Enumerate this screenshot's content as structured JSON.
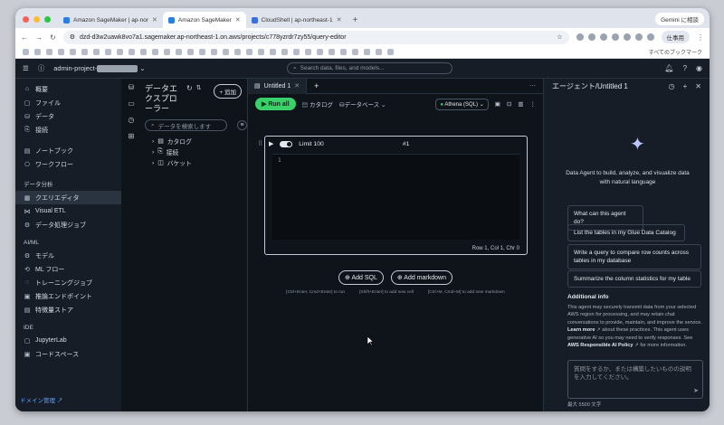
{
  "browser": {
    "tabs": [
      {
        "label": "Amazon SageMaker | ap-nor",
        "favicon_color": "#2a7de1"
      },
      {
        "label": "Amazon SageMaker",
        "favicon_color": "#2a7de1"
      },
      {
        "label": "CloudShell | ap-northeast-1",
        "favicon_color": "#3b6fd9"
      }
    ],
    "new_tab": "+",
    "gemini_label": "Gemini に相談",
    "url": "dzd-d3w2uawk8vo7a1.sagemaker.ap-northeast-1.on.aws/projects/c778yzrdr7zy55/query-editor",
    "profile_label": "仕事用",
    "bookmarks_all": "すべてのブックマーク"
  },
  "app": {
    "project_name": "admin-project-",
    "search_placeholder": "Search data, files, and models..."
  },
  "sidebar": {
    "items_top": [
      {
        "label": "概要",
        "icon": "home-icon"
      },
      {
        "label": "ファイル",
        "icon": "file-icon"
      },
      {
        "label": "データ",
        "icon": "database-icon"
      },
      {
        "label": "接続",
        "icon": "link-icon"
      }
    ],
    "items_nb": [
      {
        "label": "ノートブック",
        "icon": "notebook-icon"
      },
      {
        "label": "ワークフロー",
        "icon": "workflow-icon"
      }
    ],
    "group_analytics": "データ分析",
    "items_analytics": [
      {
        "label": "クエリエディタ",
        "icon": "query-icon"
      },
      {
        "label": "Visual ETL",
        "icon": "etl-icon"
      },
      {
        "label": "データ処理ジョブ",
        "icon": "job-icon"
      }
    ],
    "group_ml": "AI/ML",
    "items_ml": [
      {
        "label": "モデル",
        "icon": "model-icon"
      },
      {
        "label": "ML フロー",
        "icon": "mlflow-icon"
      },
      {
        "label": "トレーニングジョブ",
        "icon": "training-icon"
      },
      {
        "label": "推論エンドポイント",
        "icon": "endpoint-icon"
      },
      {
        "label": "特徴量ストア",
        "icon": "feature-store-icon"
      }
    ],
    "group_ide": "IDE",
    "items_ide": [
      {
        "label": "JupyterLab",
        "icon": "jupyter-icon"
      },
      {
        "label": "コードスペース",
        "icon": "codespace-icon"
      }
    ],
    "domain_link": "ドメイン管理"
  },
  "explorer": {
    "title": "データエクスプローラー",
    "add_label": "追加",
    "search_placeholder": "データを検索します",
    "tree": [
      {
        "label": "カタログ",
        "icon": "catalog-icon"
      },
      {
        "label": "接続",
        "icon": "link-icon"
      },
      {
        "label": "バケット",
        "icon": "bucket-icon"
      }
    ]
  },
  "editor": {
    "tab_label": "Untitled 1",
    "run_all": "Run all",
    "catalog_label": "カタログ",
    "database_label": "データベース",
    "engine_label": "Athena (SQL)",
    "limit_label": "Limit 100",
    "cell_id": "#1",
    "line_number": "1",
    "status": "Row 1,   Col 1,   Chr 0",
    "add_sql": "Add SQL",
    "add_markdown": "Add markdown",
    "hint_run": "[Ctrl+Enter, Cmd+Enter] to run",
    "hint_cell": "[Shift+Enter] to add new cell",
    "hint_md": "[Ctrl+M, Cmd+M] to add new markdown"
  },
  "agent": {
    "title": "エージェント/Untitled 1",
    "intro": "Data Agent to build, analyze, and visualize data with natural language",
    "suggestions": [
      "What can this agent do?",
      "List the tables in my Glue Data Catalog",
      "Write a query to compare row counts across tables in my database",
      "Summarize the column statistics for my table"
    ],
    "info_title": "Additional info",
    "info_text_1": "This agent may securely transmit data from your selected AWS region for processing, and may retain chat conversations to provide, maintain, and improve the service.",
    "info_learn": "Learn more",
    "info_text_2": "about these practices. This agent uses generative AI so you may need to verify responses. See",
    "info_policy": "AWS Responsible AI Policy",
    "info_text_3": "for more information.",
    "chat_placeholder": "質問をするか、または構築したいものの説明を入力してください。",
    "max_chars": "最大 5500 文字"
  }
}
